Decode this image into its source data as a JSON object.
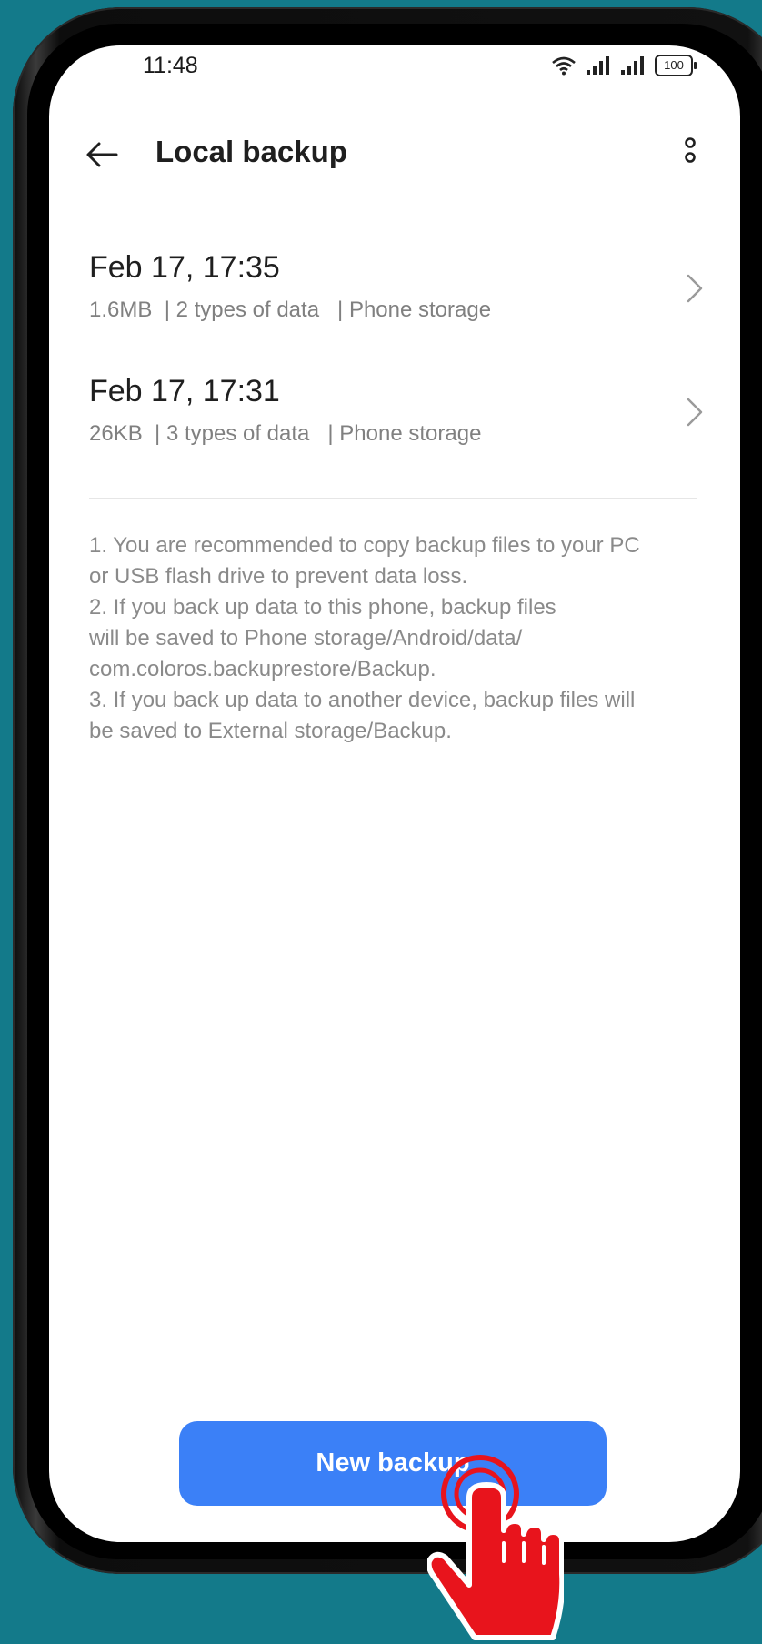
{
  "status_bar": {
    "time": "11:48",
    "battery": "100",
    "icons": [
      "wifi-icon",
      "signal-icon",
      "signal-icon",
      "battery-icon"
    ]
  },
  "header": {
    "title": "Local backup",
    "back_icon": "arrow-left-icon",
    "more_icon": "more-vertical-icon"
  },
  "backups": [
    {
      "title": "Feb 17, 17:35",
      "subtitle": "1.6MB  | 2 types of data   | Phone storage"
    },
    {
      "title": "Feb 17, 17:31",
      "subtitle": "26KB  | 3 types of data   | Phone storage"
    }
  ],
  "notes": [
    "1. You are recommended to copy backup files to your PC",
    "or USB flash drive to prevent data loss.",
    "2. If you back up data to this phone, backup files",
    "will be saved to Phone storage/Android/data/",
    "com.coloros.backuprestore/Backup.",
    "3. If you back up data to another device, backup files will",
    "be saved to External storage/Backup."
  ],
  "actions": {
    "new_backup_label": "New backup"
  },
  "colors": {
    "background": "#137a8a",
    "primary_button": "#3b80f7",
    "tap_hand": "#e8141c"
  }
}
